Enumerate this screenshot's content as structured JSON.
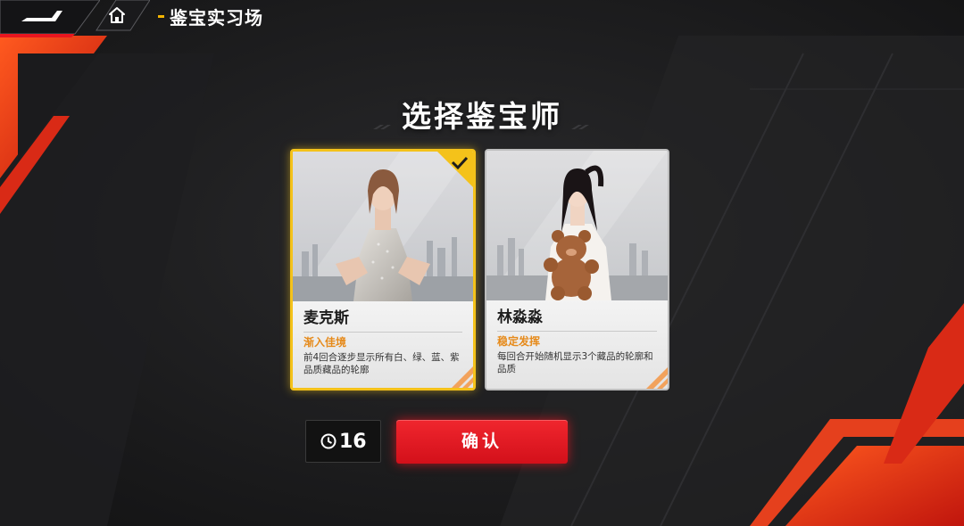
{
  "header": {
    "back_icon": "back-arrow-icon",
    "home_icon": "home-icon",
    "breadcrumb": "鉴宝实习场"
  },
  "main": {
    "title": "选择鉴宝师"
  },
  "cards": [
    {
      "name": "麦克斯",
      "trait": "渐入佳境",
      "description": "前4回合逐步显示所有白、绿、蓝、紫品质藏品的轮廓",
      "selected": true
    },
    {
      "name": "林淼淼",
      "trait": "稳定发挥",
      "description": "每回合开始随机显示3个藏品的轮廓和品质",
      "selected": false
    }
  ],
  "footer": {
    "timer_value": "16",
    "timer_icon": "clock-icon",
    "confirm_label": "确认"
  },
  "colors": {
    "accent_red": "#e8161f",
    "selected_gold": "#f4c21a",
    "trait_orange": "#e68a1a",
    "background": "#1b1b1d"
  }
}
